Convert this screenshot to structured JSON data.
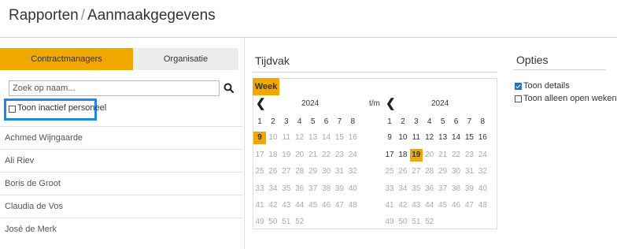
{
  "header": {
    "crumb_1": "Rapporten",
    "separator": "/",
    "crumb_2": "Aanmaakgegevens"
  },
  "tabs": {
    "active": "Contractmanagers",
    "inactive": "Organisatie"
  },
  "search": {
    "placeholder": "Zoek op naam..."
  },
  "filter": {
    "inactive_label": "Toon inactief personeel",
    "checked": false
  },
  "employees": [
    "Achmed Wijngaarde",
    "Ali Riev",
    "Boris de Groot",
    "Claudia de Vos",
    "José de Merk"
  ],
  "tijdvak": {
    "title": "Tijdvak",
    "mode_button": "Week",
    "range_sep": "t/m",
    "from": {
      "year": "2024",
      "selected": 9,
      "prev_icon": "chevron-left-icon"
    },
    "to": {
      "year": "2024",
      "selected": 19,
      "prev_icon": "chevron-left-icon"
    },
    "rows": [
      [
        1,
        2,
        3,
        4,
        5,
        6,
        7,
        8
      ],
      [
        9,
        10,
        11,
        12,
        13,
        14,
        15,
        16
      ],
      [
        17,
        18,
        19,
        20,
        21,
        22,
        23,
        24
      ],
      [
        25,
        26,
        27,
        28,
        29,
        30,
        31,
        32
      ],
      [
        33,
        34,
        35,
        36,
        37,
        38,
        39,
        40
      ],
      [
        41,
        42,
        43,
        44,
        45,
        46,
        47,
        48
      ],
      [
        49,
        50,
        51,
        52
      ]
    ]
  },
  "opties": {
    "title": "Opties",
    "options": [
      {
        "label": "Toon details",
        "checked": true
      },
      {
        "label": "Toon alleen open weken",
        "checked": false
      }
    ]
  },
  "colors": {
    "accent": "#f0a800",
    "highlight_border": "#1e88e5",
    "check": "#1e6fd6"
  }
}
